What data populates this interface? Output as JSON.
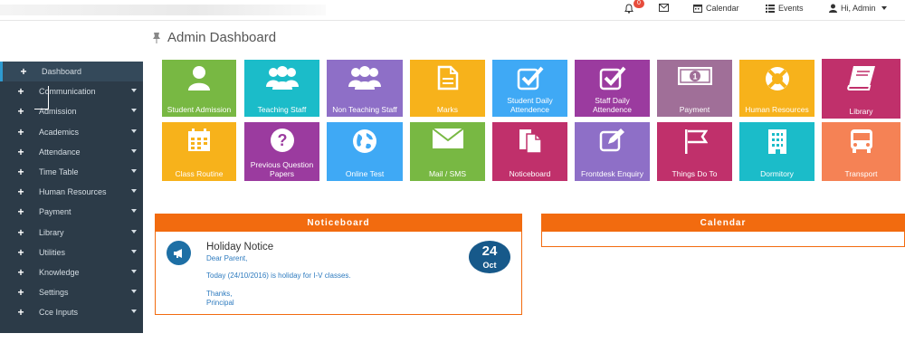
{
  "topbar": {
    "notification_count": "0",
    "calendar_label": "Calendar",
    "events_label": "Events",
    "user_label": "Hi, Admin"
  },
  "page": {
    "title": "Admin Dashboard"
  },
  "sidebar": {
    "items": [
      {
        "label": "Dashboard"
      },
      {
        "label": "Communication"
      },
      {
        "label": "Admission"
      },
      {
        "label": "Academics"
      },
      {
        "label": "Attendance"
      },
      {
        "label": "Time Table"
      },
      {
        "label": "Human Resources"
      },
      {
        "label": "Payment"
      },
      {
        "label": "Library"
      },
      {
        "label": "Utilities"
      },
      {
        "label": "Knowledge"
      },
      {
        "label": "Settings"
      },
      {
        "label": "Cce Inputs"
      }
    ]
  },
  "tiles": [
    {
      "label": "Student Admission",
      "color": "#78b843",
      "icon": "student-icon"
    },
    {
      "label": "Teaching Staff",
      "color": "#1bbcc9",
      "icon": "group-icon"
    },
    {
      "label": "Non Teaching Staff",
      "color": "#8e6fc7",
      "icon": "group-icon"
    },
    {
      "label": "Marks",
      "color": "#f7b21b",
      "icon": "document-icon"
    },
    {
      "label": "Student Daily Attendence",
      "color": "#3fa9f5",
      "icon": "checkbox-icon"
    },
    {
      "label": "Staff Daily Attendence",
      "color": "#9b3b9f",
      "icon": "checkbox-icon"
    },
    {
      "label": "Payment",
      "color": "#a06f98",
      "icon": "money-icon"
    },
    {
      "label": "Human Resources",
      "color": "#f7b21b",
      "icon": "lifebuoy-icon"
    },
    {
      "label": "Library",
      "color": "#c0306b",
      "icon": "book-icon"
    },
    {
      "label": "Class Routine",
      "color": "#f7b21b",
      "icon": "calendar-icon"
    },
    {
      "label": "Previous Question Papers",
      "color": "#9b3b9f",
      "icon": "question-icon"
    },
    {
      "label": "Online Test",
      "color": "#3fa9f5",
      "icon": "globe-icon"
    },
    {
      "label": "Mail / SMS",
      "color": "#78b843",
      "icon": "mail-icon"
    },
    {
      "label": "Noticeboard",
      "color": "#c0306b",
      "icon": "files-icon"
    },
    {
      "label": "Frontdesk Enquiry",
      "color": "#8e6fc7",
      "icon": "edit-icon"
    },
    {
      "label": "Things Do To",
      "color": "#c0306b",
      "icon": "flag-icon"
    },
    {
      "label": "Dormitory",
      "color": "#1bbcc9",
      "icon": "building-icon"
    },
    {
      "label": "Transport",
      "color": "#f58255",
      "icon": "bus-icon"
    }
  ],
  "noticeboard": {
    "header": "Noticeboard",
    "notice_title": "Holiday Notice",
    "line1": "Dear Parent,",
    "line2": "Today (24/10/2016) is holiday for I-V classes.",
    "line3": "Thanks,",
    "line4": "Principal",
    "day": "24",
    "month": "Oct"
  },
  "calendar": {
    "header": "Calendar"
  }
}
